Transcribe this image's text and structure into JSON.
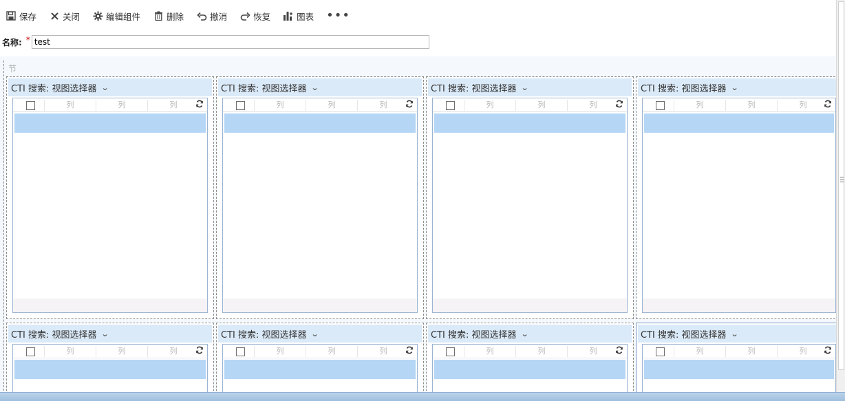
{
  "toolbar": {
    "save": "保存",
    "close": "关闭",
    "edit_component": "编辑组件",
    "delete": "删除",
    "undo": "撤消",
    "redo": "恢复",
    "chart": "图表",
    "more": "•••"
  },
  "form": {
    "name_label": "名称:",
    "required_mark": "*",
    "name_value": "test"
  },
  "section": {
    "label": "节"
  },
  "component": {
    "title": "CTI 搜索: 视图选择器",
    "column_label": "列",
    "icons": {
      "dropdown": "chevron-down-icon",
      "refresh": "refresh-icon",
      "checkbox": "checkbox-icon"
    }
  },
  "colors": {
    "header_bg": "#dbeaf8",
    "selected_row": "#b5d6f5",
    "section_bg": "#f5f9fd"
  }
}
